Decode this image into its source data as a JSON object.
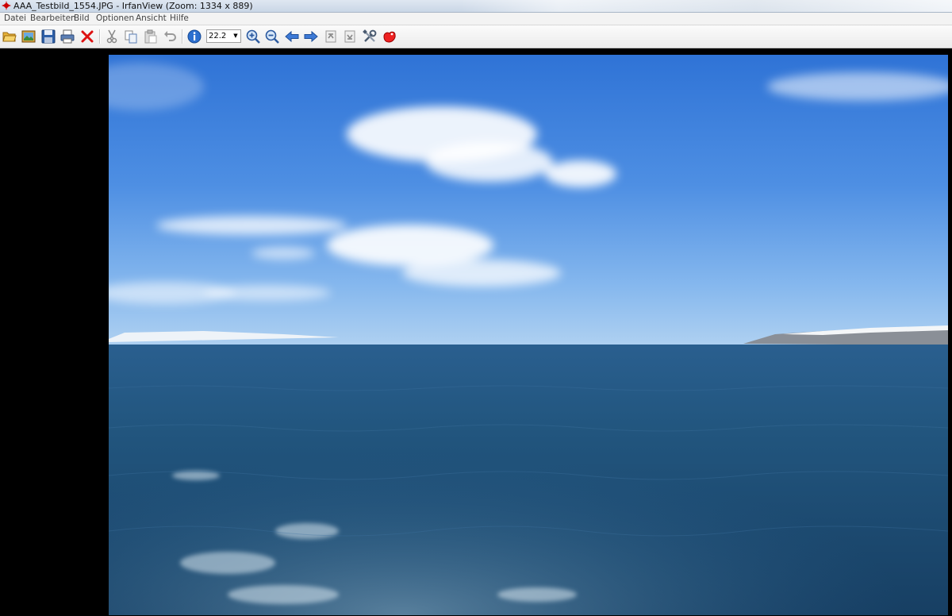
{
  "window": {
    "title": "AAA_Testbild_1554.JPG - IrfanView (Zoom: 1334 x 889)"
  },
  "menu": {
    "items": [
      "Datei",
      "Bearbeiten",
      "Bild",
      "Optionen",
      "Ansicht",
      "Hilfe"
    ]
  },
  "toolbar": {
    "buttons": [
      "open-icon",
      "thumbnails-icon",
      "save-icon",
      "print-icon",
      "delete-icon",
      "cut-icon",
      "copy-icon",
      "paste-icon",
      "undo-icon",
      "info-icon",
      "zoom-in-icon",
      "zoom-out-icon",
      "previous-icon",
      "next-icon",
      "first-page-icon",
      "last-page-icon",
      "settings-icon",
      "plugin-icon"
    ],
    "zoom_value": "22.2"
  },
  "image": {
    "description_colors": {
      "sky_top": "#2f73d6",
      "sky_horizon": "#a9cdf0",
      "sea": "#1e4f79"
    }
  }
}
